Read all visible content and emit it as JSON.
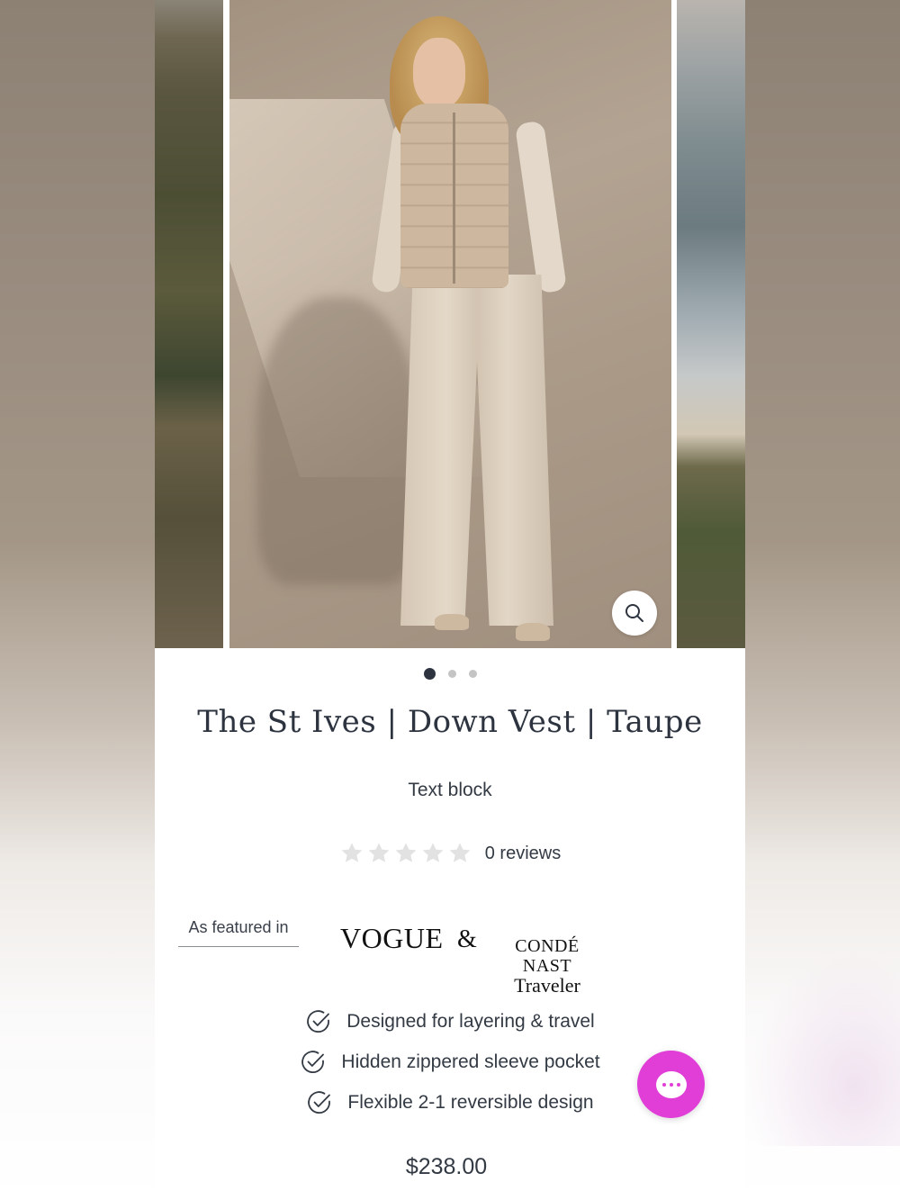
{
  "carousel": {
    "slide_count": 3,
    "active_index": 0
  },
  "product": {
    "title": "The St Ives | Down Vest | Taupe",
    "text_block": "Text block",
    "rating": 0,
    "reviews_label": "0 reviews",
    "price": "$238.00"
  },
  "featured": {
    "label": "As featured in",
    "vogue": "VOGUE",
    "ampersand": "&",
    "conde_nast_line1": "CONDÉ NAST",
    "conde_nast_line2": "Traveler"
  },
  "features": [
    {
      "icon": "check-circle-icon",
      "text": "Designed for layering & travel"
    },
    {
      "icon": "check-circle-icon",
      "text": "Hidden zippered sleeve pocket"
    },
    {
      "icon": "check-circle-icon",
      "text": "Flexible 2-1 reversible design"
    }
  ],
  "colors": {
    "text": "#333a44",
    "title": "#2d3440",
    "chat_accent": "#e03ed6",
    "star_empty": "#e2e2e2",
    "dot_active": "#2d3440",
    "dot_inactive": "#c4c4c4"
  },
  "icons": {
    "zoom": "search-icon",
    "chat": "chat-icon",
    "star": "star-icon"
  }
}
